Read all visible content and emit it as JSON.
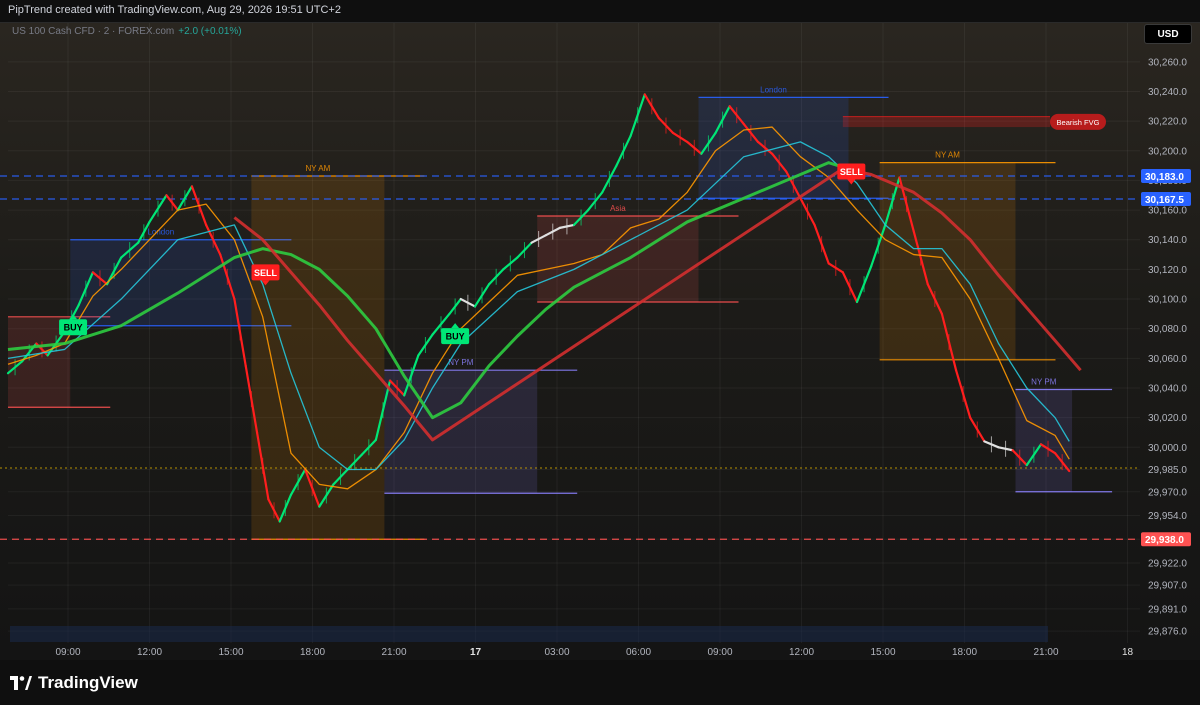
{
  "header": {
    "caption": "PipTrend created with TradingView.com, Aug 29, 2026 19:51 UTC+2"
  },
  "legend": {
    "symbol": "US 100 Cash CFD · 2 · FOREX.com",
    "change": "+2.0 (+0.01%)",
    "currency": "USD"
  },
  "footer": {
    "brand": "TradingView"
  },
  "colors": {
    "background": "#0f0f0f",
    "bull": "#00e676",
    "bear": "#ff1e1e",
    "neutral": "#e0e0e0",
    "ema_fast": "#ff9800",
    "ema_mid": "#26c6da",
    "ema_slow": "#2ecc40",
    "ema_long": "#d32f2f",
    "level_blue": "#2962ff",
    "level_red": "#ff5252"
  },
  "chart_data": {
    "type": "line",
    "title": "",
    "x_ticks": [
      "09:00",
      "12:00",
      "15:00",
      "18:00",
      "21:00",
      "17",
      "03:00",
      "06:00",
      "09:00",
      "12:00",
      "15:00",
      "18:00",
      "21:00",
      "18"
    ],
    "y_ticks": [
      "30,260.0",
      "30,240.0",
      "30,220.0",
      "30,200.0",
      "30,180.0",
      "30,160.0",
      "30,140.0",
      "30,120.0",
      "30,100.0",
      "30,080.0",
      "30,060.0",
      "30,040.0",
      "30,020.0",
      "30,000.0",
      "29,985.0",
      "29,970.0",
      "29,954.0",
      "29,938.0",
      "29,922.0",
      "29,907.0",
      "29,891.0",
      "29,876.0"
    ],
    "ylim": [
      29868,
      30270
    ],
    "x_range": [
      0,
      40
    ],
    "price_labels": [
      {
        "text": "30,183.0",
        "value": 30183.0,
        "color": "#2962ff"
      },
      {
        "text": "30,167.5",
        "value": 30167.5,
        "color": "#2962ff"
      },
      {
        "text": "29,938.0",
        "value": 29938.0,
        "color": "#ff5252"
      }
    ],
    "horizontal_lines": [
      {
        "value": 30183.0,
        "color": "#2962ff",
        "style": "dashed"
      },
      {
        "value": 30167.5,
        "color": "#2962ff",
        "style": "dashed"
      },
      {
        "value": 29938.0,
        "color": "#ff5252",
        "style": "dashed"
      },
      {
        "value": 29986.0,
        "color": "#c8a000",
        "style": "dotted"
      }
    ],
    "sessions": [
      {
        "name": "",
        "x0": 0,
        "x1": 2.2,
        "top": 30088,
        "bottom": 30027,
        "color": "#ff5252"
      },
      {
        "name": "London",
        "x0": 2.2,
        "x1": 8.6,
        "top": 30140,
        "bottom": 30082,
        "color": "#2962ff"
      },
      {
        "name": "NY AM",
        "x0": 8.6,
        "x1": 13.3,
        "top": 30183,
        "bottom": 29938,
        "color": "#ff9800"
      },
      {
        "name": "NY PM",
        "x0": 13.3,
        "x1": 18.7,
        "top": 30052,
        "bottom": 29969,
        "color": "#8c82ff"
      },
      {
        "name": "Asia",
        "x0": 18.7,
        "x1": 24.4,
        "top": 30156,
        "bottom": 30098,
        "color": "#ff5252"
      },
      {
        "name": "London",
        "x0": 24.4,
        "x1": 29.7,
        "top": 30236,
        "bottom": 30168,
        "color": "#2962ff"
      },
      {
        "name": "NY AM",
        "x0": 30.8,
        "x1": 35.6,
        "top": 30192,
        "bottom": 30059,
        "color": "#ff9800"
      },
      {
        "name": "NY PM",
        "x0": 35.6,
        "x1": 37.6,
        "top": 30039,
        "bottom": 29970,
        "color": "#8c82ff"
      }
    ],
    "signals": [
      {
        "type": "BUY",
        "x": 2.3,
        "price": 30081
      },
      {
        "type": "SELL",
        "x": 9.1,
        "price": 30118
      },
      {
        "type": "BUY",
        "x": 15.8,
        "price": 30075
      },
      {
        "type": "SELL",
        "x": 29.8,
        "price": 30186
      }
    ],
    "fvg": {
      "label": "Bearish FVG",
      "x0": 29.5,
      "value_top": 30223,
      "value_bottom": 30216
    },
    "series": [
      {
        "color_key": "bull_bear",
        "x": [
          0,
          0.5,
          1.0,
          1.4,
          2.0,
          2.5,
          3.0,
          3.5,
          4.0,
          4.6,
          5.0,
          5.6,
          6.0,
          6.5,
          7.0,
          7.5,
          8.0,
          8.4,
          8.8,
          9.2,
          9.6,
          10.0,
          10.5,
          11.0,
          11.5,
          12.0,
          12.5,
          13.0,
          13.5,
          14.0,
          14.5,
          15.0,
          15.6,
          16.0,
          16.5,
          17.0,
          17.5,
          18.0,
          18.5,
          19.0,
          19.5,
          20.0,
          20.5,
          21.0,
          21.5,
          22.0,
          22.5,
          23.0,
          23.5,
          24.0,
          24.5,
          25.0,
          25.5,
          26.0,
          26.5,
          27.0,
          27.5,
          28.0,
          28.5,
          29.0,
          29.5,
          30.0,
          30.5,
          31.0,
          31.5,
          32.0,
          32.5,
          33.0,
          33.5,
          34.0,
          34.5,
          35.0,
          35.5,
          36.0,
          36.5,
          37.0,
          37.5
        ],
        "y": [
          30050,
          30058,
          30070,
          30062,
          30078,
          30096,
          30118,
          30110,
          30128,
          30138,
          30152,
          30170,
          30160,
          30176,
          30150,
          30130,
          30100,
          30055,
          30010,
          29965,
          29950,
          29968,
          29985,
          29960,
          29975,
          29985,
          29995,
          30005,
          30045,
          30035,
          30062,
          30076,
          30090,
          30100,
          30095,
          30110,
          30120,
          30128,
          30138,
          30143,
          30148,
          30150,
          30160,
          30172,
          30190,
          30210,
          30238,
          30222,
          30212,
          30206,
          30198,
          30212,
          30230,
          30218,
          30206,
          30198,
          30186,
          30168,
          30150,
          30124,
          30118,
          30098,
          30122,
          30150,
          30182,
          30146,
          30110,
          30090,
          30052,
          30020,
          30004,
          30000,
          29998,
          29988,
          30002,
          29996,
          29984
        ]
      },
      {
        "color_key": "ema_fast",
        "x": [
          0,
          1.0,
          2.0,
          3.0,
          4.0,
          5.0,
          6.0,
          7.0,
          8.0,
          9.0,
          10.0,
          11.0,
          12.0,
          13.0,
          14.0,
          15.0,
          16.0,
          17.0,
          18.0,
          19.0,
          20.0,
          21.0,
          22.0,
          23.0,
          24.0,
          25.0,
          26.0,
          27.0,
          28.0,
          29.0,
          30.0,
          31.0,
          32.0,
          33.0,
          34.0,
          35.0,
          36.0,
          37.0,
          37.5
        ],
        "y": [
          30056,
          30062,
          30070,
          30102,
          30120,
          30140,
          30160,
          30164,
          30140,
          30088,
          29996,
          29975,
          29972,
          29985,
          30010,
          30050,
          30080,
          30098,
          30116,
          30120,
          30124,
          30130,
          30148,
          30154,
          30172,
          30200,
          30214,
          30216,
          30196,
          30182,
          30160,
          30140,
          30130,
          30128,
          30100,
          30060,
          30018,
          30008,
          29992
        ]
      },
      {
        "color_key": "ema_mid",
        "x": [
          0,
          2.0,
          4.0,
          6.0,
          8.0,
          9.0,
          10.0,
          11.0,
          12.0,
          13.0,
          14.0,
          15.0,
          16.0,
          18.0,
          20.0,
          22.0,
          24.0,
          26.0,
          28.0,
          29.0,
          30.0,
          31.0,
          32.0,
          33.0,
          34.0,
          35.0,
          36.0,
          37.0,
          37.5
        ],
        "y": [
          30060,
          30066,
          30100,
          30140,
          30150,
          30110,
          30050,
          30000,
          29985,
          29985,
          30005,
          30040,
          30070,
          30105,
          30120,
          30140,
          30160,
          30196,
          30206,
          30196,
          30178,
          30150,
          30134,
          30134,
          30110,
          30070,
          30040,
          30020,
          30004
        ]
      },
      {
        "color_key": "ema_slow",
        "x": [
          0,
          2.0,
          4.0,
          6.0,
          8.0,
          9.0,
          10.0,
          11.0,
          12.0,
          13.0,
          14.0,
          15.0,
          16.0,
          17.0,
          18.0,
          19.0,
          20.0,
          21.0,
          22.0,
          24.0,
          26.0,
          28.0,
          29.0,
          30.0
        ],
        "y": [
          30066,
          30070,
          30082,
          30104,
          30128,
          30134,
          30130,
          30120,
          30102,
          30080,
          30048,
          30020,
          30030,
          30055,
          30075,
          30093,
          30108,
          30118,
          30128,
          30152,
          30168,
          30184,
          30192,
          30186
        ]
      },
      {
        "color_key": "ema_long",
        "x": [
          8.0,
          9.0,
          10.0,
          11.0,
          12.0,
          13.0,
          14.0,
          15.0,
          29.5,
          30.5,
          32.0,
          33.0,
          34.0,
          35.0,
          36.0,
          37.0,
          37.9
        ],
        "y": [
          30155,
          30140,
          30118,
          30096,
          30072,
          30050,
          30028,
          30005,
          30188,
          30184,
          30172,
          30158,
          30140,
          30116,
          30094,
          30072,
          30052
        ]
      }
    ]
  }
}
